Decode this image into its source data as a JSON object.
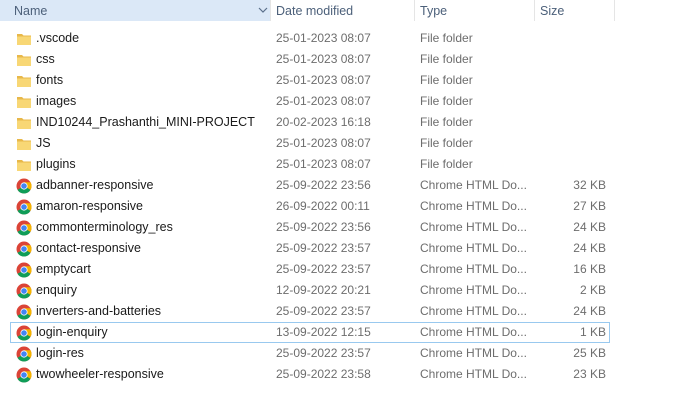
{
  "columns": {
    "name": "Name",
    "date": "Date modified",
    "type": "Type",
    "size": "Size"
  },
  "files": [
    {
      "name": ".vscode",
      "date": "25-01-2023 08:07",
      "type": "File folder",
      "size": "",
      "icon": "folder-icon"
    },
    {
      "name": "css",
      "date": "25-01-2023 08:07",
      "type": "File folder",
      "size": "",
      "icon": "folder-icon"
    },
    {
      "name": "fonts",
      "date": "25-01-2023 08:07",
      "type": "File folder",
      "size": "",
      "icon": "folder-icon"
    },
    {
      "name": "images",
      "date": "25-01-2023 08:07",
      "type": "File folder",
      "size": "",
      "icon": "folder-icon"
    },
    {
      "name": "IND10244_Prashanthi_MINI-PROJECT",
      "date": "20-02-2023 16:18",
      "type": "File folder",
      "size": "",
      "icon": "folder-icon"
    },
    {
      "name": "JS",
      "date": "25-01-2023 08:07",
      "type": "File folder",
      "size": "",
      "icon": "folder-icon"
    },
    {
      "name": "plugins",
      "date": "25-01-2023 08:07",
      "type": "File folder",
      "size": "",
      "icon": "folder-icon"
    },
    {
      "name": "adbanner-responsive",
      "date": "25-09-2022 23:56",
      "type": "Chrome HTML Do...",
      "size": "32 KB",
      "icon": "chrome-icon"
    },
    {
      "name": "amaron-responsive",
      "date": "26-09-2022 00:11",
      "type": "Chrome HTML Do...",
      "size": "27 KB",
      "icon": "chrome-icon"
    },
    {
      "name": "commonterminology_res",
      "date": "25-09-2022 23:56",
      "type": "Chrome HTML Do...",
      "size": "24 KB",
      "icon": "chrome-icon"
    },
    {
      "name": "contact-responsive",
      "date": "25-09-2022 23:57",
      "type": "Chrome HTML Do...",
      "size": "24 KB",
      "icon": "chrome-icon"
    },
    {
      "name": "emptycart",
      "date": "25-09-2022 23:57",
      "type": "Chrome HTML Do...",
      "size": "16 KB",
      "icon": "chrome-icon"
    },
    {
      "name": "enquiry",
      "date": "12-09-2022 20:21",
      "type": "Chrome HTML Do...",
      "size": "2 KB",
      "icon": "chrome-icon"
    },
    {
      "name": "inverters-and-batteries",
      "date": "25-09-2022 23:57",
      "type": "Chrome HTML Do...",
      "size": "24 KB",
      "icon": "chrome-icon"
    },
    {
      "name": "login-enquiry",
      "date": "13-09-2022 12:15",
      "type": "Chrome HTML Do...",
      "size": "1 KB",
      "icon": "chrome-icon",
      "selected": true
    },
    {
      "name": "login-res",
      "date": "25-09-2022 23:57",
      "type": "Chrome HTML Do...",
      "size": "25 KB",
      "icon": "chrome-icon"
    },
    {
      "name": "twowheeler-responsive",
      "date": "25-09-2022 23:58",
      "type": "Chrome HTML Do...",
      "size": "23 KB",
      "icon": "chrome-icon"
    }
  ],
  "colors": {
    "header_highlight": "#dbe8f7",
    "selection_border": "#99c9ef",
    "folder": "#f8d775"
  }
}
